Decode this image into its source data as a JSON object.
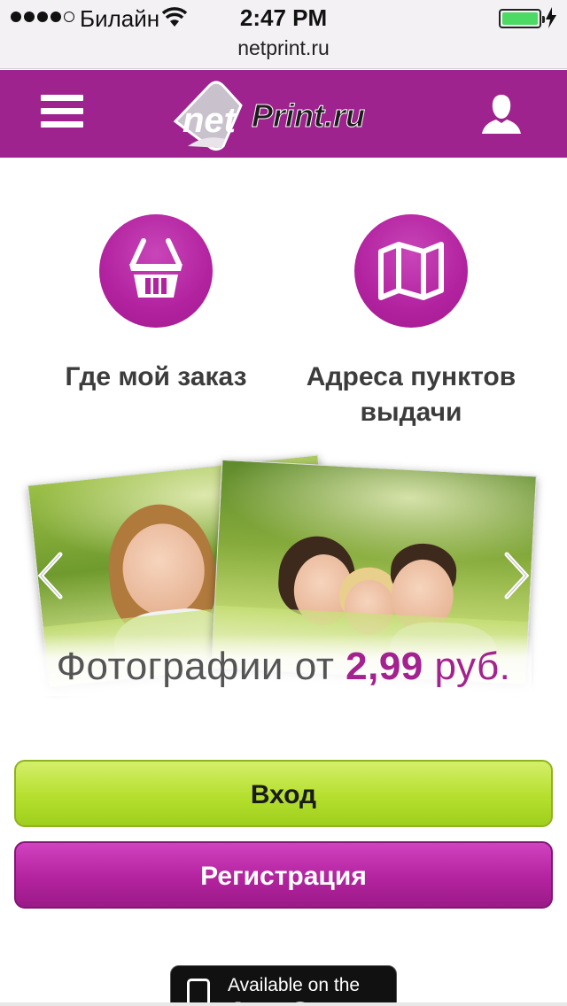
{
  "status_bar": {
    "carrier": "Билайн",
    "time": "2:47 PM",
    "signal_bars_filled": 4,
    "signal_bars_total": 5,
    "battery_level": 1.0,
    "charging": true
  },
  "browser": {
    "url": "netprint.ru"
  },
  "header": {
    "logo_net": "net",
    "logo_print": "Print.ru",
    "brand_color": "#9e238f"
  },
  "quick_links": [
    {
      "label": "Где мой заказ",
      "icon": "basket-icon"
    },
    {
      "label": "Адреса пунктов выдачи",
      "icon": "map-icon"
    }
  ],
  "banner": {
    "text_prefix": "Фотографии от",
    "price": "2,99",
    "currency": "руб."
  },
  "buttons": {
    "login": "Вход",
    "register": "Регистрация"
  },
  "app_store": {
    "line1": "Available on the",
    "line2": "App Store"
  },
  "colors": {
    "accent": "#a3228f",
    "login_green": "#b5df2e",
    "register_purple": "#b4239f"
  }
}
